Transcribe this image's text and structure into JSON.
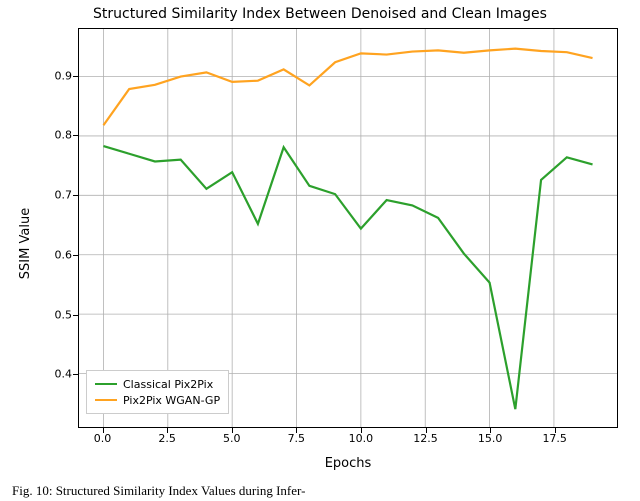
{
  "chart_data": {
    "type": "line",
    "title": "Structured Similarity Index Between Denoised and Clean Images",
    "xlabel": "Epochs",
    "ylabel": "SSIM Value",
    "xlim": [
      -0.95,
      19.95
    ],
    "ylim": [
      0.31,
      0.98
    ],
    "xticks": [
      0.0,
      2.5,
      5.0,
      7.5,
      10.0,
      12.5,
      15.0,
      17.5
    ],
    "xtick_labels": [
      "0.0",
      "2.5",
      "5.0",
      "7.5",
      "10.0",
      "12.5",
      "15.0",
      "17.5"
    ],
    "yticks": [
      0.4,
      0.5,
      0.6,
      0.7,
      0.8,
      0.9
    ],
    "ytick_labels": [
      "0.4",
      "0.5",
      "0.6",
      "0.7",
      "0.8",
      "0.9"
    ],
    "x": [
      0,
      1,
      2,
      3,
      4,
      5,
      6,
      7,
      8,
      9,
      10,
      11,
      12,
      13,
      14,
      15,
      16,
      17,
      18,
      19
    ],
    "series": [
      {
        "name": "Classical Pix2Pix",
        "color": "#2ca02c",
        "values": [
          0.783,
          0.77,
          0.757,
          0.76,
          0.711,
          0.739,
          0.652,
          0.781,
          0.716,
          0.702,
          0.644,
          0.692,
          0.683,
          0.662,
          0.602,
          0.553,
          0.34,
          0.726,
          0.764,
          0.752
        ]
      },
      {
        "name": "Pix2Pix WGAN-GP",
        "color": "#ffa320",
        "values": [
          0.818,
          0.879,
          0.886,
          0.9,
          0.907,
          0.891,
          0.893,
          0.912,
          0.885,
          0.924,
          0.939,
          0.937,
          0.942,
          0.944,
          0.94,
          0.944,
          0.947,
          0.943,
          0.941,
          0.931
        ]
      }
    ],
    "legend": {
      "items": [
        "Classical Pix2Pix",
        "Pix2Pix WGAN-GP"
      ],
      "position": "lower left"
    },
    "grid": true
  },
  "caption": "Fig. 10: Structured Similarity Index Values during Infer-"
}
